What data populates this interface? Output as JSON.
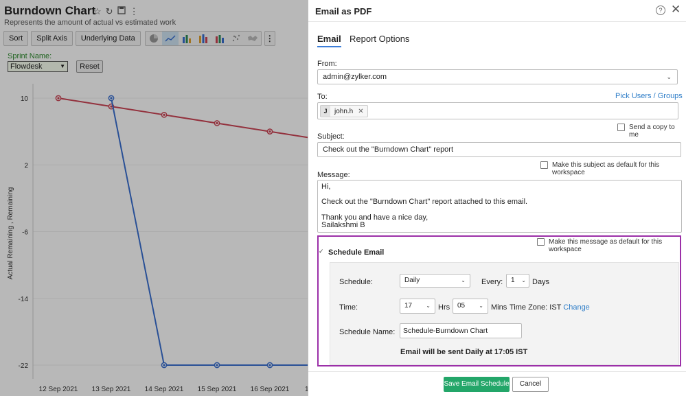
{
  "report": {
    "title": "Burndown Chart",
    "subtitle": "Represents the amount of actual vs estimated work",
    "toolbar": {
      "sort": "Sort",
      "split_axis": "Split Axis",
      "underlying_data": "Underlying Data"
    },
    "filter_label": "Sprint Name:",
    "filter_value": "Flowdesk",
    "reset_label": "Reset"
  },
  "chart_data": {
    "type": "line",
    "ylabel": "Actual Remaining , Remaining",
    "ylim": [
      -22,
      10
    ],
    "y_ticks": [
      10,
      2,
      -6,
      -14,
      -22
    ],
    "categories": [
      "12 Sep 2021",
      "13 Sep 2021",
      "14 Sep 2021",
      "15 Sep 2021",
      "16 Sep 2021"
    ],
    "series": [
      {
        "color": "#cc4455",
        "values": [
          10,
          9,
          8,
          7,
          6
        ]
      },
      {
        "color": "#3a6fd0",
        "values": [
          null,
          10,
          -22,
          -22,
          -22
        ]
      }
    ]
  },
  "dialog": {
    "title": "Email as PDF",
    "tabs": [
      "Email",
      "Report Options"
    ],
    "from_label": "From:",
    "from_value": "admin@zylker.com",
    "to_label": "To:",
    "pick_users": "Pick Users / Groups",
    "recipient_initial": "J",
    "recipient_name": "john.h",
    "send_copy": "Send a copy to me",
    "subject_label": "Subject:",
    "subject_value": "Check out the \"Burndown Chart\" report",
    "subject_default": "Make this subject as default for this workspace",
    "message_label": "Message:",
    "message_value": "Hi,\n\nCheck out the \"Burndown Chart\" report attached to this email.\n\nThank you and have a nice day,\nSailakshmi B",
    "message_default": "Make this message as default for this workspace",
    "schedule_title": "Schedule Email",
    "schedule_label": "Schedule:",
    "schedule_value": "Daily",
    "every_label": "Every:",
    "every_value": "1",
    "days_label": "Days",
    "time_label": "Time:",
    "hours_value": "17",
    "hrs_label": "Hrs",
    "minutes_value": "05",
    "mins_label": "Mins",
    "timezone_label": "Time Zone: IST",
    "change_label": "Change",
    "schedule_name_label": "Schedule Name:",
    "schedule_name_value": "Schedule-Burndown Chart",
    "schedule_note": "Email will be sent Daily at 17:05 IST",
    "save_button": "Save Email Schedule",
    "cancel_button": "Cancel"
  }
}
